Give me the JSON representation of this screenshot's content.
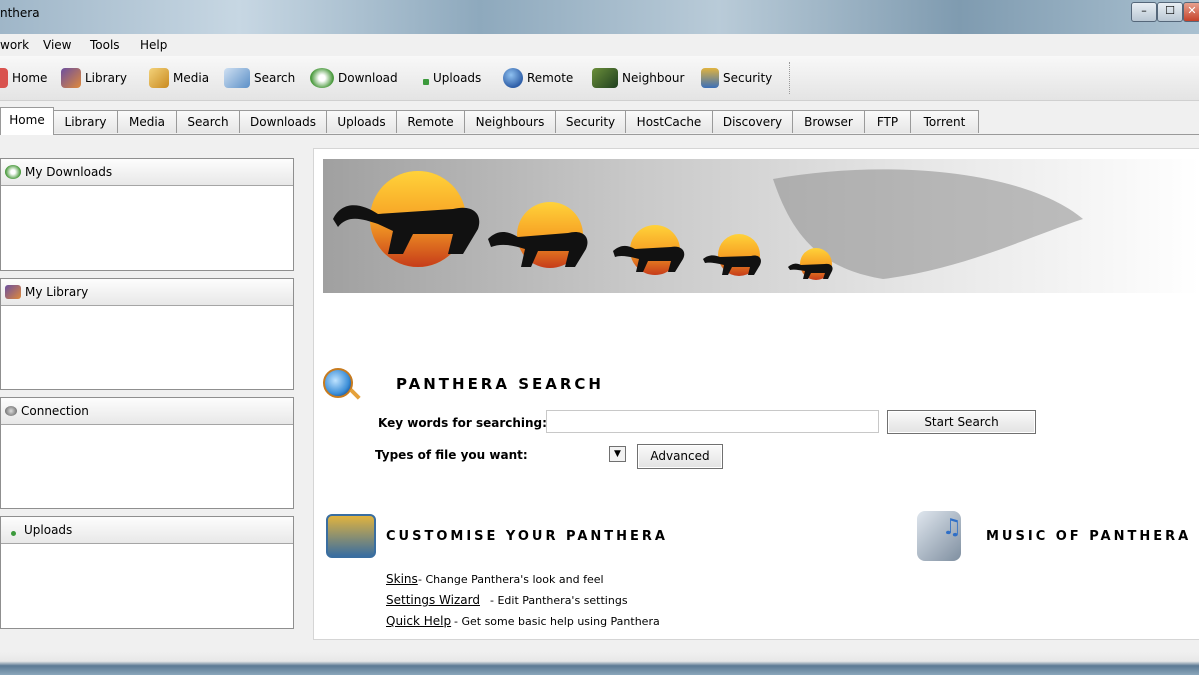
{
  "window": {
    "title": "nthera"
  },
  "menu": [
    "work",
    "View",
    "Tools",
    "Help"
  ],
  "toolbar": [
    {
      "label": "Home",
      "icon": "home-icon",
      "color": "#d9534f"
    },
    {
      "label": "Library",
      "icon": "library-icon",
      "color": "#6b4fa0"
    },
    {
      "label": "Media",
      "icon": "media-icon",
      "color": "#e0a030"
    },
    {
      "label": "Search",
      "icon": "search-icon",
      "color": "#5b8fc7"
    },
    {
      "label": "Download",
      "icon": "download-icon",
      "color": "#4a9a3d"
    },
    {
      "label": "Uploads",
      "icon": "uploads-icon",
      "color": "#3c9a3c"
    },
    {
      "label": "Remote",
      "icon": "remote-icon",
      "color": "#2f5fa8"
    },
    {
      "label": "Neighbour",
      "icon": "neighbour-icon",
      "color": "#3a7a3a"
    },
    {
      "label": "Security",
      "icon": "security-icon",
      "color": "#3b6fb8"
    }
  ],
  "tabs": [
    "Home",
    "Library",
    "Media",
    "Search",
    "Downloads",
    "Uploads",
    "Remote",
    "Neighbours",
    "Security",
    "HostCache",
    "Discovery",
    "Browser",
    "FTP",
    "Torrent"
  ],
  "sidebar": [
    {
      "title": "My Downloads",
      "icon": "downloads-icon"
    },
    {
      "title": "My Library",
      "icon": "library-icon"
    },
    {
      "title": "Connection",
      "icon": "connection-icon"
    },
    {
      "title": "Uploads",
      "icon": "uploads-icon"
    }
  ],
  "search": {
    "title": "PANTHERA SEARCH",
    "keywords_label": "Key words for searching:",
    "keywords_value": "",
    "types_label": "Types of file you want:",
    "start_button": "Start Search",
    "advanced_button": "Advanced"
  },
  "customise": {
    "title": "CUSTOMISE YOUR PANTHERA",
    "links": [
      {
        "label": "Skins",
        "desc": "- Change Panthera's look and feel"
      },
      {
        "label": "Settings Wizard",
        "desc": "- Edit Panthera's settings"
      },
      {
        "label": "Quick Help",
        "desc": "- Get some basic help using Panthera"
      }
    ]
  },
  "music": {
    "title": "MUSIC OF PANTHERA"
  }
}
